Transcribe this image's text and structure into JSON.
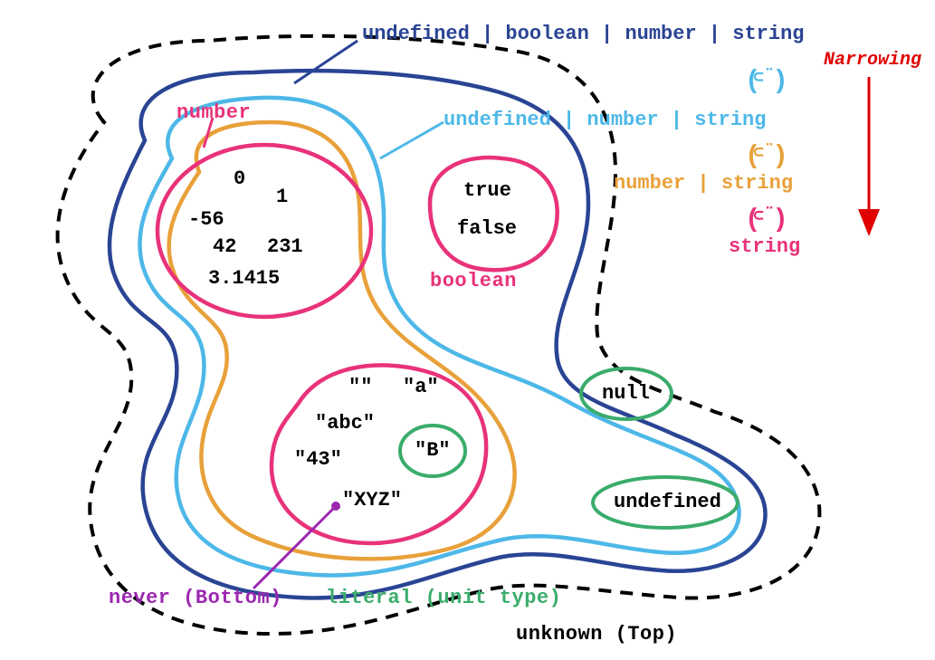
{
  "colors": {
    "unknown": "#000000",
    "navy": "#2a4494",
    "sky": "#4db8e8",
    "orange": "#e8a13a",
    "string": "#e8327a",
    "pink": "#e8327a",
    "green": "#3aac6b",
    "purple": "#9b27b0",
    "red": "#e00000"
  },
  "labels": {
    "number": "number",
    "boolean": "boolean",
    "never": "never (Bottom)",
    "literal": "literal (unit type)",
    "unknown": "unknown (Top)",
    "narrowing": "Narrowing"
  },
  "legend": {
    "l1": "undefined | boolean | number | string",
    "l2": "undefined | number | string",
    "l3": "number | string",
    "l4": "string",
    "subset": "⊂̈"
  },
  "values": {
    "numbers": {
      "v0": "0",
      "v1": "1",
      "n56": "-56",
      "v42": "42",
      "v231": "231",
      "pi": "3.1415"
    },
    "booleans": {
      "t": "true",
      "f": "false"
    },
    "strings": {
      "empty": "\"\"",
      "a": "\"a\"",
      "abc": "\"abc\"",
      "B": "\"B\"",
      "v43": "\"43\"",
      "xyz": "\"XYZ\""
    },
    "null": "null",
    "undefined": "undefined"
  },
  "chart_data": {
    "type": "venn-set-diagram",
    "description": "TypeScript type hierarchy showing progressive narrowing of union types from unknown (Top) down to individual literal types and never (Bottom)",
    "top_type": "unknown",
    "bottom_type": "never",
    "narrowing_chain": [
      "undefined | boolean | number | string",
      "undefined | number | string",
      "number | string",
      "string"
    ],
    "primitive_sets": {
      "number": [
        "0",
        "1",
        "-56",
        "42",
        "231",
        "3.1415"
      ],
      "boolean": [
        "true",
        "false"
      ],
      "string": [
        "\"\"",
        "\"a\"",
        "\"abc\"",
        "\"B\"",
        "\"43\"",
        "\"XYZ\""
      ],
      "null": [
        "null"
      ],
      "undefined": [
        "undefined"
      ]
    },
    "literal_examples": [
      "\"B\"",
      "null",
      "undefined"
    ],
    "containment": {
      "unknown": [
        "undefined | boolean | number | string",
        "null",
        "undefined"
      ],
      "undefined | boolean | number | string": [
        "undefined | number | string",
        "boolean"
      ],
      "undefined | number | string": [
        "number | string",
        "undefined"
      ],
      "number | string": [
        "number",
        "string"
      ],
      "string": [
        "\"B\""
      ]
    }
  }
}
